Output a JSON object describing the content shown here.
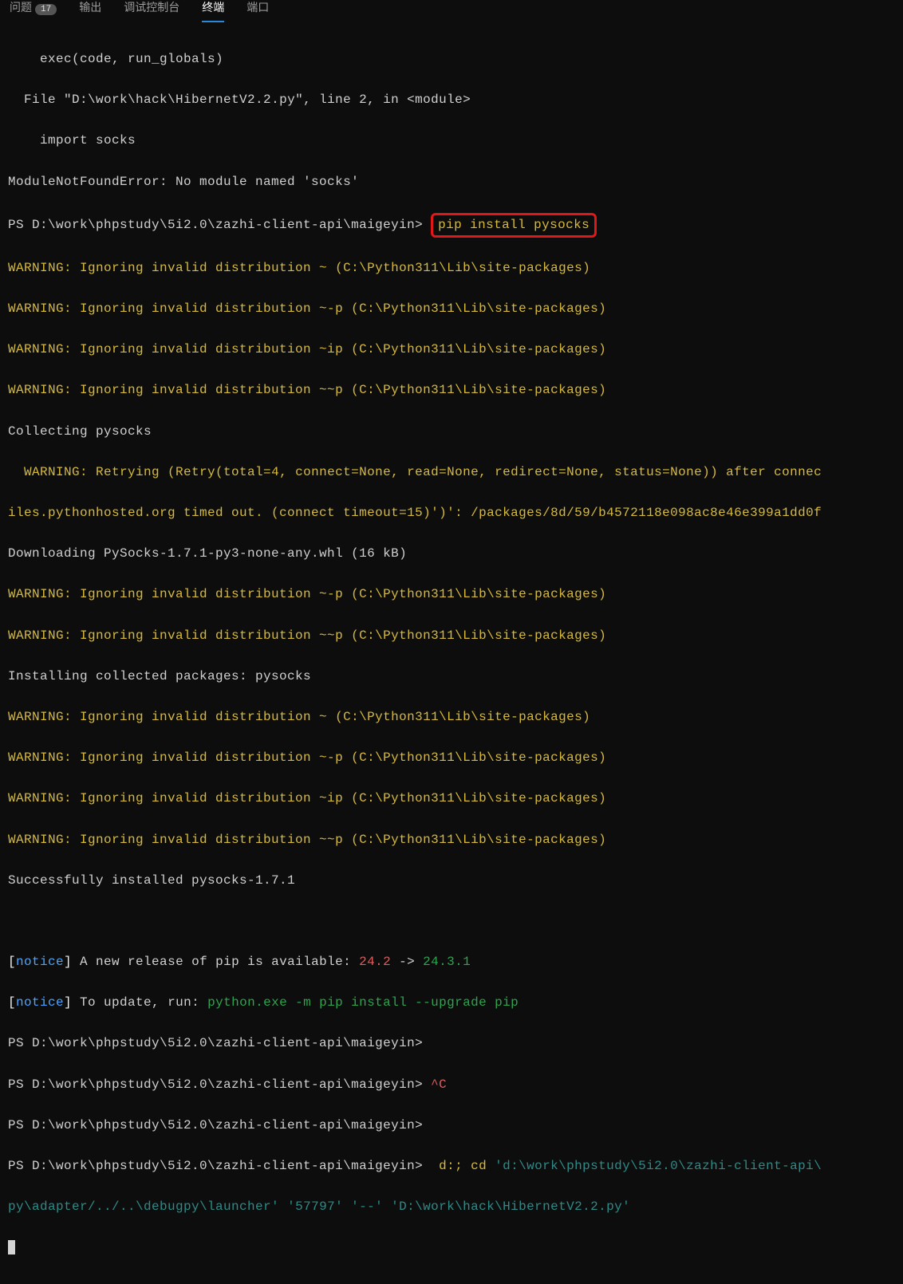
{
  "tabs": {
    "t0": "问题",
    "badge": "17",
    "t1": "输出",
    "t2": "调试控制台",
    "t3": "终端",
    "t4": "端口"
  },
  "l": {
    "exec": "    exec(code, run_globals)",
    "file": "  File \"D:\\work\\hack\\HibernetV2.2.py\", line 2, in <module>",
    "import": "    import socks",
    "err": "ModuleNotFoundError: No module named 'socks'",
    "ps1": "PS D:\\work\\phpstudy\\5i2.0\\zazhi-client-api\\maigeyin> ",
    "pip": "pip install pysocks",
    "w1": "WARNING: Ignoring invalid distribution ~ (C:\\Python311\\Lib\\site-packages)",
    "w2": "WARNING: Ignoring invalid distribution ~-p (C:\\Python311\\Lib\\site-packages)",
    "w3": "WARNING: Ignoring invalid distribution ~ip (C:\\Python311\\Lib\\site-packages)",
    "w4": "WARNING: Ignoring invalid distribution ~~p (C:\\Python311\\Lib\\site-packages)",
    "col": "Collecting pysocks",
    "retry": "  WARNING: Retrying (Retry(total=4, connect=None, read=None, redirect=None, status=None)) after connec",
    "retry2": "iles.pythonhosted.org timed out. (connect timeout=15)')': /packages/8d/59/b4572118e098ac8e46e399a1dd0f",
    "dl": "Downloading PySocks-1.7.1-py3-none-any.whl (16 kB)",
    "inst": "Installing collected packages: pysocks",
    "succ": "Successfully installed pysocks-1.7.1",
    "lbr": "[",
    "rbr": "] ",
    "notice": "notice",
    "n1": "A new release of pip is available: ",
    "n1a": "24.2",
    "n1b": " -> ",
    "n1c": "24.3.1",
    "n2": "To update, run: ",
    "n2cmd": "python.exe -m pip install --upgrade pip",
    "ctrl": "^C",
    "dcd": " d:; cd ",
    "path1": "'d:\\work\\phpstudy\\5i2.0\\zazhi-client-api\\",
    "cont1": "py\\adapter/../..\\debugpy\\launcher'",
    "port": " '57797' ",
    "dd": "'--' ",
    "path2": "'D:\\work\\hack\\HibernetV2.2.py'"
  }
}
